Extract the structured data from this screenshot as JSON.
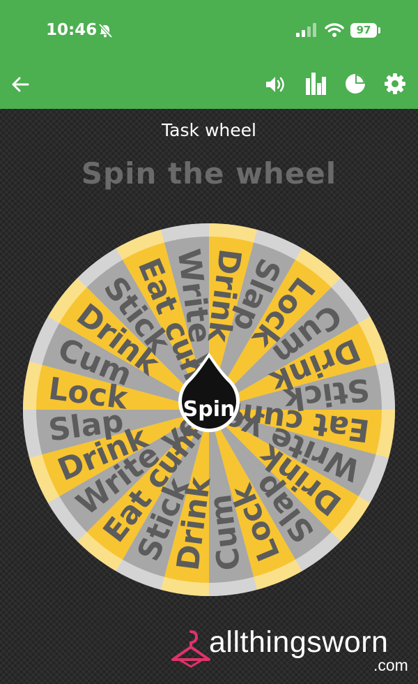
{
  "status_bar": {
    "time": "10:46",
    "battery": "97"
  },
  "app_bar": {
    "back_icon": "arrow-left-icon",
    "icons": [
      "volume-icon",
      "bar-chart-icon",
      "pie-chart-icon",
      "gear-icon"
    ]
  },
  "wheel": {
    "title": "Task wheel",
    "subtitle": "Spin the wheel",
    "spin_label": "Spin",
    "segments": [
      "Drink",
      "Slap",
      "Lock",
      "Cum",
      "Drink",
      "Stick",
      "Eat cum",
      "Write yes",
      "Drink",
      "Slap",
      "Lock",
      "Cum",
      "Drink",
      "Stick",
      "Eat cum",
      "Write yes",
      "Drink",
      "Slap",
      "Lock",
      "Cum",
      "Drink",
      "Stick",
      "Eat cum",
      "Write yes"
    ],
    "colors": {
      "yellow": "#f7c531",
      "grey": "#a7a7a7",
      "text": "#5c5c5c"
    }
  },
  "watermark": {
    "brand": "allthingsworn",
    "suffix": ".com"
  }
}
